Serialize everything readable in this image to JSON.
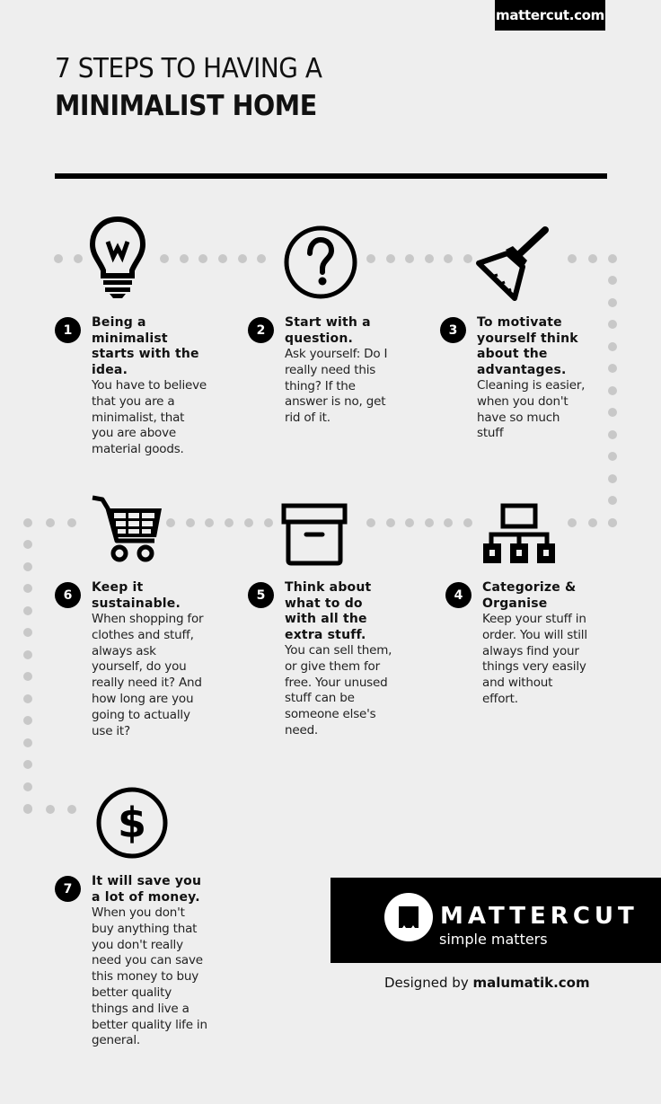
{
  "header": {
    "site_badge": "mattercut.com",
    "title_line1": "7 STEPS TO HAVING A",
    "title_line2": "MINIMALIST HOME"
  },
  "colors": {
    "background": "#eeeeee",
    "ink": "#000000",
    "dots": "#c8c8c8",
    "brand_text": "#ffffff"
  },
  "steps": [
    {
      "number": "1",
      "icon": "lightbulb-icon",
      "title": "Being a minimalist starts with the idea.",
      "body": "You have to believe that you are a minimalist, that you are above material goods."
    },
    {
      "number": "2",
      "icon": "question-circle-icon",
      "title": "Start with a question.",
      "body": "Ask yourself: Do I really need this thing? If the answer is no, get rid of it."
    },
    {
      "number": "3",
      "icon": "broom-icon",
      "title": "To motivate yourself think about the advantages.",
      "body": "Cleaning is easier, when you don't have so much stuff"
    },
    {
      "number": "4",
      "icon": "hierarchy-icon",
      "title": "Categorize & Organise",
      "body": "Keep your stuff  in order. You will still always find your things very easily and without effort."
    },
    {
      "number": "5",
      "icon": "storage-box-icon",
      "title": "Think about what to do with all the extra stuff.",
      "body": "You can sell them, or give them for free. Your unused stuff can be someone else's need."
    },
    {
      "number": "6",
      "icon": "shopping-cart-icon",
      "title": "Keep it sustainable.",
      "body": "When shopping for clothes and stuff, always ask yourself, do you really need it? And how long are you going to actually use it?"
    },
    {
      "number": "7",
      "icon": "dollar-circle-icon",
      "title": "It will save you a lot of money.",
      "body": "When you don't buy anything that you don't really need you can save this money to buy better quality things and live a better quality life in general."
    }
  ],
  "footer": {
    "brand_name": "MATTERCUT",
    "brand_tagline": "simple matters",
    "credit_prefix": "Designed by ",
    "credit_name": "malumatik.com"
  }
}
